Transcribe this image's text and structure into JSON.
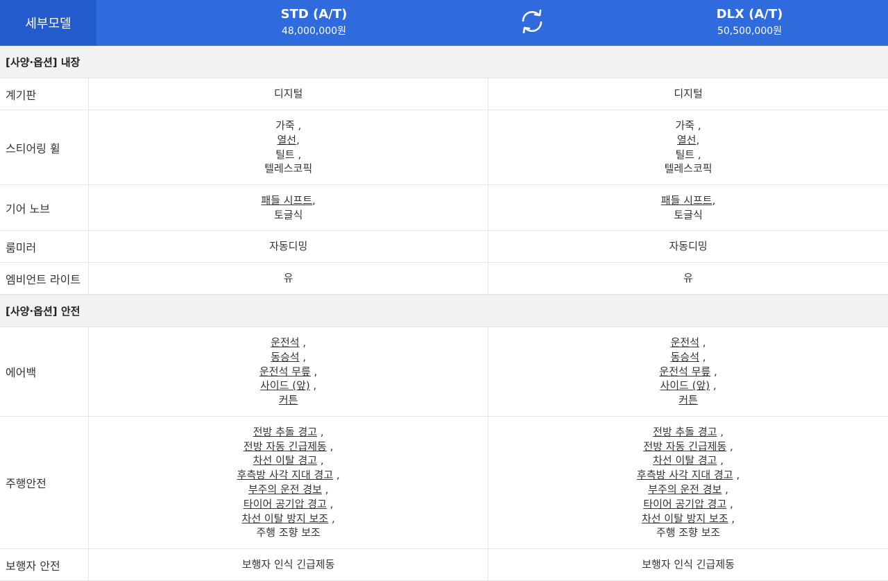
{
  "header": {
    "label": "세부모델",
    "models": [
      {
        "name": "STD (A/T)",
        "price": "48,000,000원"
      },
      {
        "name": "DLX (A/T)",
        "price": "50,500,000원"
      }
    ],
    "swap_icon": "refresh-icon",
    "accent": "#2f6bdc"
  },
  "sections": [
    {
      "title": "[사양·옵션] 내장",
      "rows": [
        {
          "label": "계기판",
          "height": 46,
          "std": [
            {
              "text": "디지털",
              "link": false
            }
          ],
          "dlx": [
            {
              "text": "디지털",
              "link": false
            }
          ]
        },
        {
          "label": "스티어링 휠",
          "height": 108,
          "std": [
            {
              "text": "가죽",
              "link": false,
              "sep": " ,"
            },
            {
              "text": "열선",
              "link": true,
              "sep": ","
            },
            {
              "text": "틸트",
              "link": false,
              "sep": " ,"
            },
            {
              "text": "텔레스코픽",
              "link": false
            }
          ],
          "dlx": [
            {
              "text": "가죽",
              "link": false,
              "sep": " ,"
            },
            {
              "text": "열선",
              "link": true,
              "sep": ","
            },
            {
              "text": "틸트",
              "link": false,
              "sep": " ,"
            },
            {
              "text": "텔레스코픽",
              "link": false
            }
          ]
        },
        {
          "label": "기어 노브",
          "height": 66,
          "std": [
            {
              "text": "패들 시프트",
              "link": true,
              "sep": ","
            },
            {
              "text": "토글식",
              "link": false
            }
          ],
          "dlx": [
            {
              "text": "패들 시프트",
              "link": true,
              "sep": ","
            },
            {
              "text": "토글식",
              "link": false
            }
          ]
        },
        {
          "label": "룸미러",
          "height": 46,
          "std": [
            {
              "text": "자동디밍",
              "link": false
            }
          ],
          "dlx": [
            {
              "text": "자동디밍",
              "link": false
            }
          ]
        },
        {
          "label": "엠비언트 라이트",
          "height": 46,
          "std": [
            {
              "text": "유",
              "link": false
            }
          ],
          "dlx": [
            {
              "text": "유",
              "link": false
            }
          ]
        }
      ]
    },
    {
      "title": "[사양·옵션] 안전",
      "rows": [
        {
          "label": "에어백",
          "height": 129,
          "std": [
            {
              "text": "운전석",
              "link": true,
              "sep": " ,"
            },
            {
              "text": "동승석",
              "link": true,
              "sep": " ,"
            },
            {
              "text": "운전석 무릎",
              "link": true,
              "sep": " ,"
            },
            {
              "text": "사이드 (앞)",
              "link": true,
              "sep": " ,"
            },
            {
              "text": "커튼",
              "link": true
            }
          ],
          "dlx": [
            {
              "text": "운전석",
              "link": true,
              "sep": " ,"
            },
            {
              "text": "동승석",
              "link": true,
              "sep": " ,"
            },
            {
              "text": "운전석 무릎",
              "link": true,
              "sep": " ,"
            },
            {
              "text": "사이드 (앞)",
              "link": true,
              "sep": " ,"
            },
            {
              "text": "커튼",
              "link": true
            }
          ]
        },
        {
          "label": "주행안전",
          "height": 191,
          "std": [
            {
              "text": "전방 추돌 경고",
              "link": true,
              "sep": " ,"
            },
            {
              "text": "전방 자동 긴급제동",
              "link": true,
              "sep": " ,"
            },
            {
              "text": "차선 이탈 경고",
              "link": true,
              "sep": " ,"
            },
            {
              "text": "후측방 사각 지대 경고",
              "link": true,
              "sep": " ,"
            },
            {
              "text": "부주의 운전 경보",
              "link": true,
              "sep": " ,"
            },
            {
              "text": "타이어 공기압 경고",
              "link": true,
              "sep": " ,"
            },
            {
              "text": "차선 이탈 방지 보조",
              "link": true,
              "sep": " ,"
            },
            {
              "text": "주행 조향 보조",
              "link": false
            }
          ],
          "dlx": [
            {
              "text": "전방 추돌 경고",
              "link": true,
              "sep": " ,"
            },
            {
              "text": "전방 자동 긴급제동",
              "link": true,
              "sep": " ,"
            },
            {
              "text": "차선 이탈 경고",
              "link": true,
              "sep": " ,"
            },
            {
              "text": "후측방 사각 지대 경고",
              "link": true,
              "sep": " ,"
            },
            {
              "text": "부주의 운전 경보",
              "link": true,
              "sep": " ,"
            },
            {
              "text": "타이어 공기압 경고",
              "link": true,
              "sep": " ,"
            },
            {
              "text": "차선 이탈 방지 보조",
              "link": true,
              "sep": " ,"
            },
            {
              "text": "주행 조향 보조",
              "link": false
            }
          ]
        },
        {
          "label": "보행자 안전",
          "height": 46,
          "std": [
            {
              "text": "보행자 인식 긴급제동",
              "link": false
            }
          ],
          "dlx": [
            {
              "text": "보행자 인식 긴급제동",
              "link": false
            }
          ]
        }
      ]
    }
  ]
}
